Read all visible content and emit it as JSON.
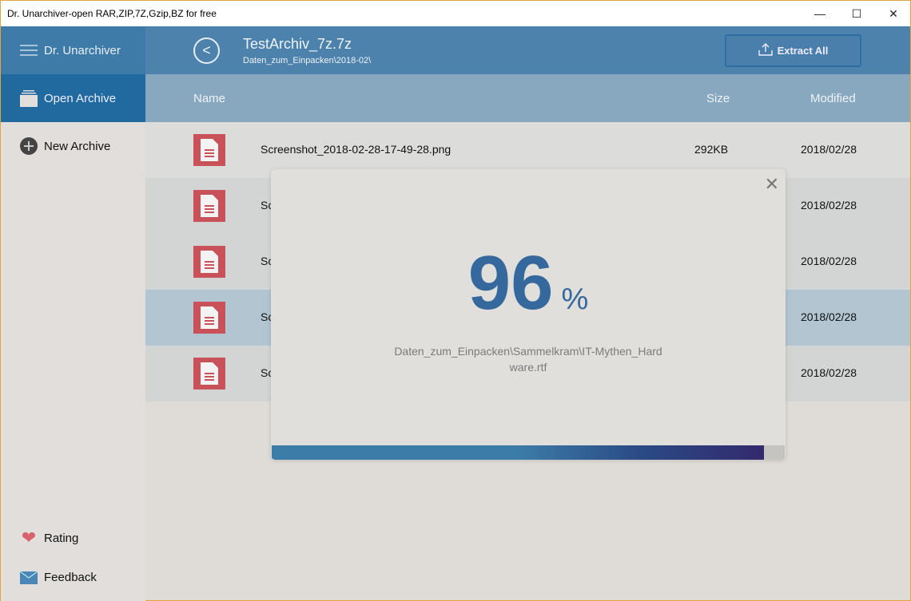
{
  "window": {
    "title": "Dr. Unarchiver-open RAR,ZIP,7Z,Gzip,BZ for free"
  },
  "sidebar": {
    "app_name": "Dr. Unarchiver",
    "items": [
      {
        "label": "Open Archive",
        "icon": "folder-icon"
      },
      {
        "label": "New Archive",
        "icon": "plus-circle-icon"
      }
    ],
    "bottom": [
      {
        "label": "Rating",
        "icon": "heart-icon"
      },
      {
        "label": "Feedback",
        "icon": "mail-icon"
      }
    ]
  },
  "header": {
    "title": "TestArchiv_7z.7z",
    "path": "Daten_zum_Einpacken\\2018-02\\",
    "extract_label": "Extract All"
  },
  "columns": {
    "name": "Name",
    "size": "Size",
    "modified": "Modified"
  },
  "files": [
    {
      "name": "Screenshot_2018-02-28-17-49-28.png",
      "size": "292KB",
      "modified": "2018/02/28"
    },
    {
      "name": "Sc",
      "size": "",
      "modified": "2018/02/28"
    },
    {
      "name": "Sc",
      "size": "",
      "modified": "2018/02/28"
    },
    {
      "name": "Sc",
      "size": "",
      "modified": "2018/02/28"
    },
    {
      "name": "Sc",
      "size": "",
      "modified": "2018/02/28"
    }
  ],
  "progress": {
    "percent": "96",
    "sign": "%",
    "value": 0.96,
    "current_file": "Daten_zum_Einpacken\\Sammelkram\\IT-Mythen_Hardware.rtf"
  }
}
